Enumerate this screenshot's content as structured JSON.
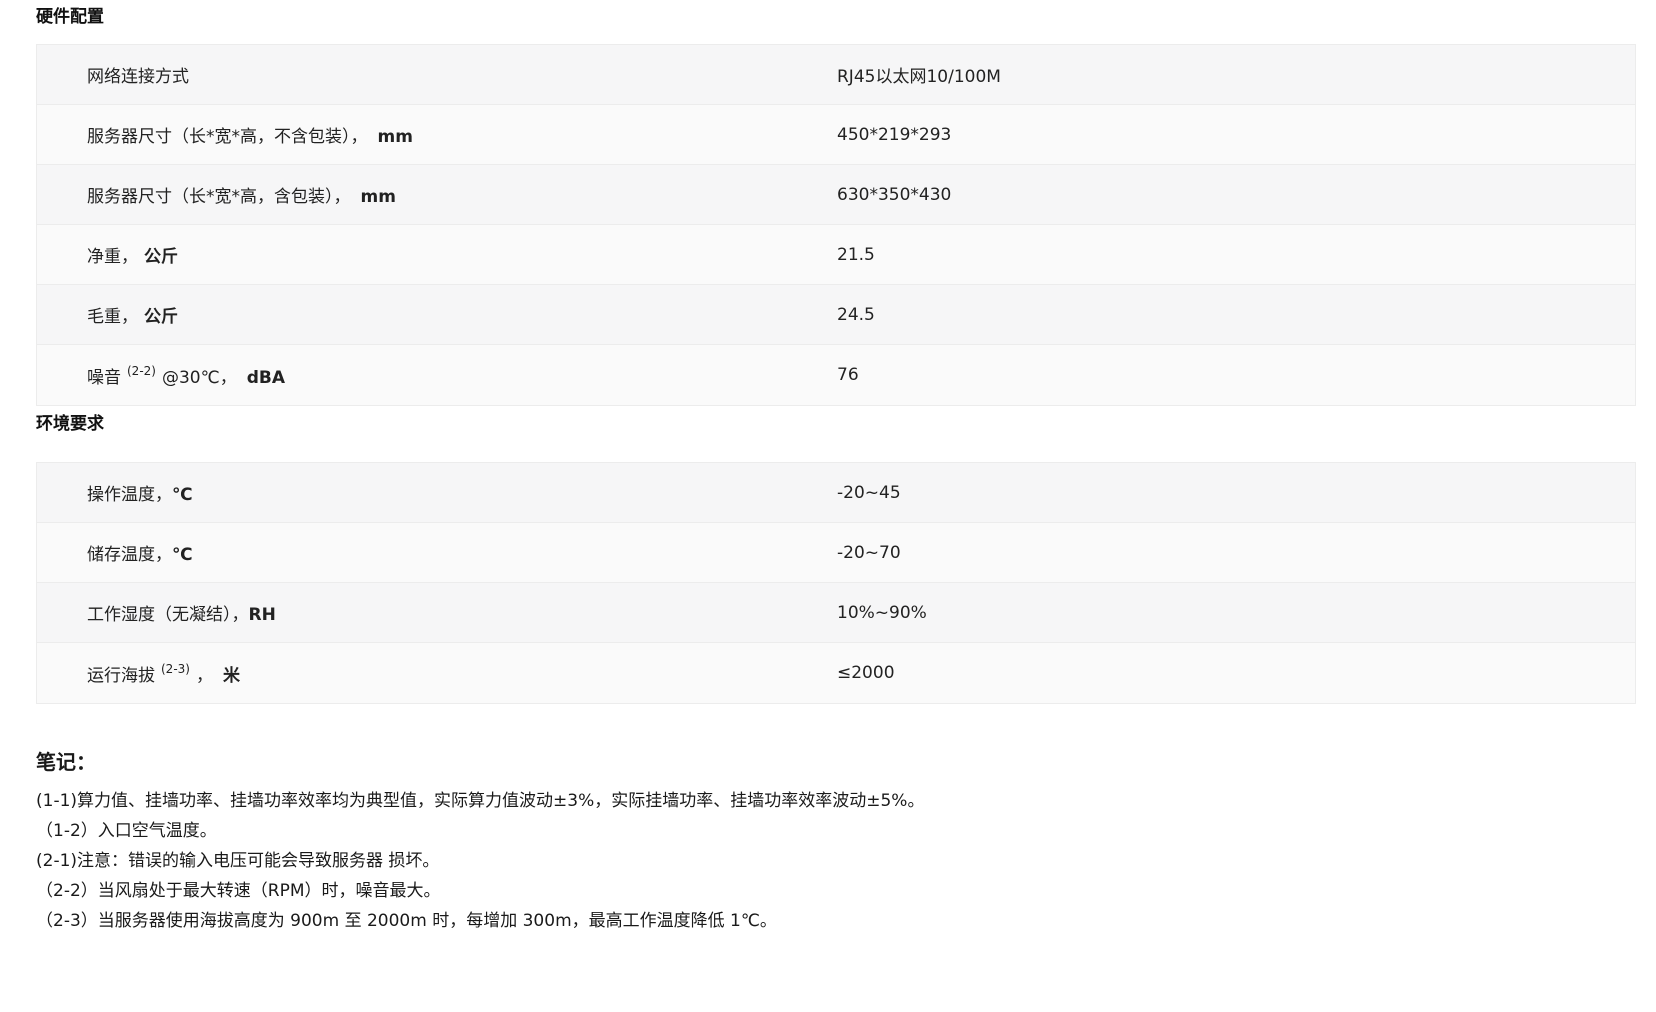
{
  "sections": [
    {
      "title": "硬件配置",
      "rows": [
        {
          "label": "网络连接方式",
          "sup": "",
          "suffix": "",
          "unit": "",
          "value": "RJ45以太网10/100M"
        },
        {
          "label": "服务器尺寸（长*宽*高，不含包装），",
          "sup": "",
          "suffix": "",
          "unit": "mm",
          "value": "450*219*293"
        },
        {
          "label": "服务器尺寸（长*宽*高，含包装），",
          "sup": "",
          "suffix": "",
          "unit": "mm",
          "value": "630*350*430"
        },
        {
          "label": "净重，",
          "sup": "",
          "suffix": "",
          "unit": "公斤",
          "value": "21.5"
        },
        {
          "label": "毛重，",
          "sup": "",
          "suffix": "",
          "unit": "公斤",
          "value": "24.5"
        },
        {
          "label": "噪音",
          "sup": "(2-2)",
          "suffix": "@30℃，",
          "unit": "dBA",
          "value": "76"
        }
      ]
    },
    {
      "title": "环境要求",
      "rows": [
        {
          "label": "操作温度，",
          "sup": "",
          "suffix": "",
          "unit": "℃",
          "value": "-20~45"
        },
        {
          "label": "储存温度，",
          "sup": "",
          "suffix": "",
          "unit": "℃",
          "value": "-20~70"
        },
        {
          "label": "工作湿度（无凝结），",
          "sup": "",
          "suffix": "",
          "unit": "RH",
          "value": "10%~90%"
        },
        {
          "label": "运行海拔",
          "sup": "(2-3)",
          "suffix": "，",
          "unit": "米",
          "value": "≤2000"
        }
      ]
    }
  ],
  "notes": {
    "title": "笔记：",
    "lines": [
      "(1-1)算力值、挂墙功率、挂墙功率效率均为典型值，实际算力值波动±3%，实际挂墙功率、挂墙功率效率波动±5%。",
      "（1-2）入口空气温度。",
      "(2-1)注意：错误的输入电压可能会导致服务器 损坏。",
      "（2-2）当风扇处于最大转速（RPM）时，噪音最大。",
      "（2-3）当服务器使用海拔高度为 900m 至 2000m 时，每增加 300m，最高工作温度降低 1℃。"
    ]
  }
}
